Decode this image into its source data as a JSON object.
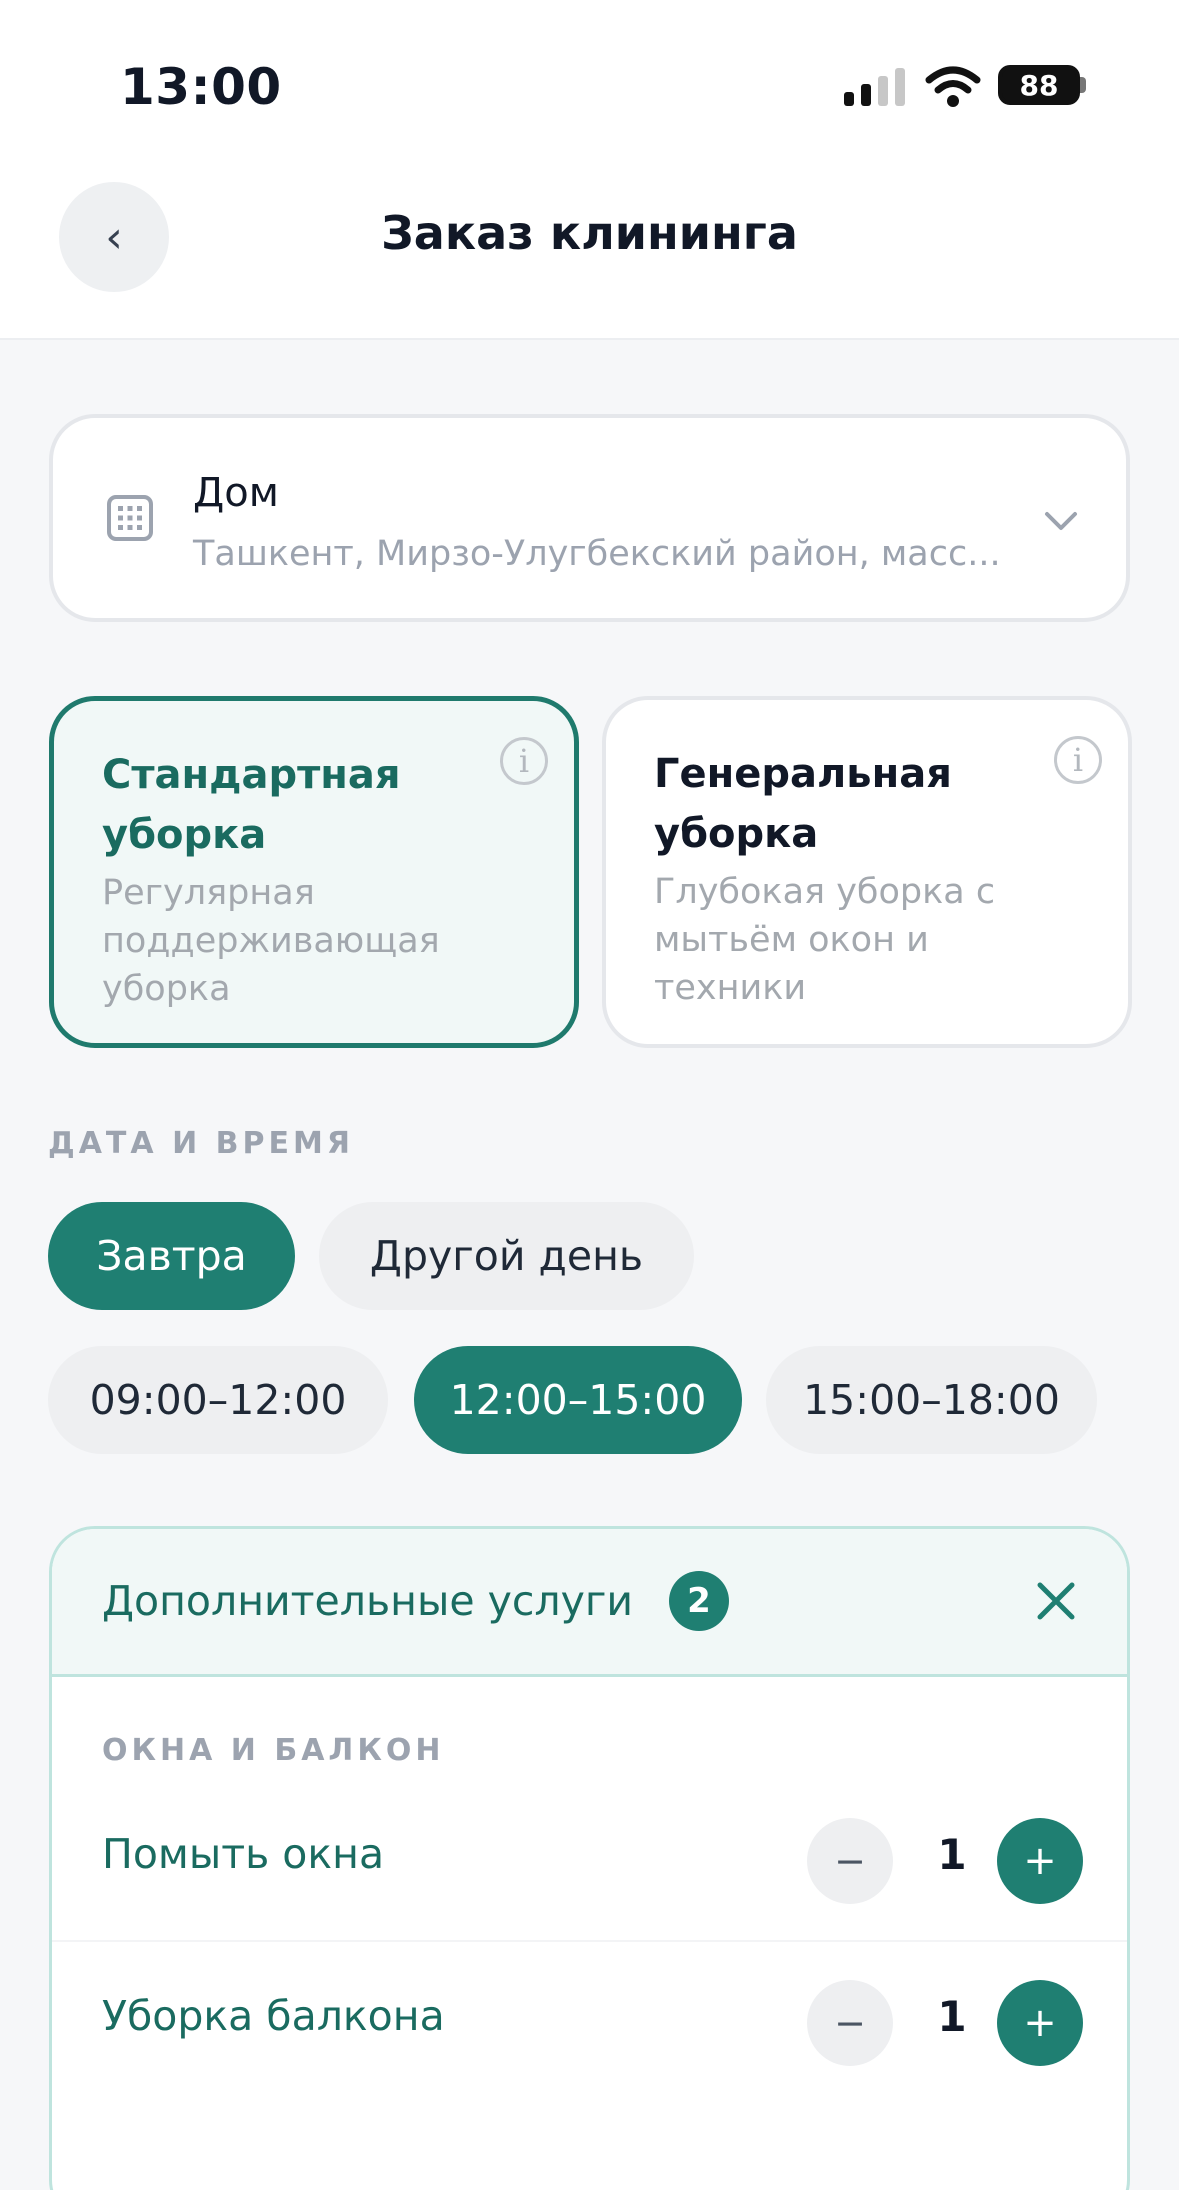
{
  "status_bar": {
    "time": "13:00",
    "battery": "88"
  },
  "header": {
    "back_icon": "chevron-left-icon",
    "back_glyph": "‹",
    "title": "Заказ клининга"
  },
  "address": {
    "icon": "building-icon",
    "name": "Дом",
    "line": "Ташкент, Мирзо-Улугбекский район, масс...",
    "chevron": "chevron-down-icon"
  },
  "cleaning_types": [
    {
      "title_line1": "Стандартная",
      "title_line2": "уборка",
      "desc_line1": "Регулярная",
      "desc_line2": "поддерживающая",
      "desc_line3": "уборка",
      "selected": true
    },
    {
      "title_line1": "Генеральная",
      "title_line2": "уборка",
      "desc_line1": "Глубокая уборка с",
      "desc_line2": "мытьём окон и",
      "desc_line3": "техники",
      "selected": false
    }
  ],
  "info_glyph": "i",
  "datetime": {
    "label": "ДАТА И ВРЕМЯ",
    "days": [
      {
        "label": "Завтра",
        "active": true
      },
      {
        "label": "Другой день",
        "active": false
      }
    ],
    "slots": [
      {
        "label": "09:00–12:00",
        "active": false
      },
      {
        "label": "12:00–15:00",
        "active": true
      },
      {
        "label": "15:00–18:00",
        "active": false
      }
    ]
  },
  "addons": {
    "title": "Дополнительные услуги",
    "badge": "2",
    "close_icon": "close-icon",
    "category": "ОКНА И БАЛКОН",
    "items": [
      {
        "label": "Помыть окна",
        "minus": "−",
        "qty": "1",
        "plus": "+"
      },
      {
        "label": "Уборка балкона",
        "minus": "−",
        "qty": "1",
        "plus": "+"
      }
    ]
  },
  "colors": {
    "accent": "#1f7f72",
    "accent_text": "#1a6b60",
    "muted": "#9ca3af"
  }
}
